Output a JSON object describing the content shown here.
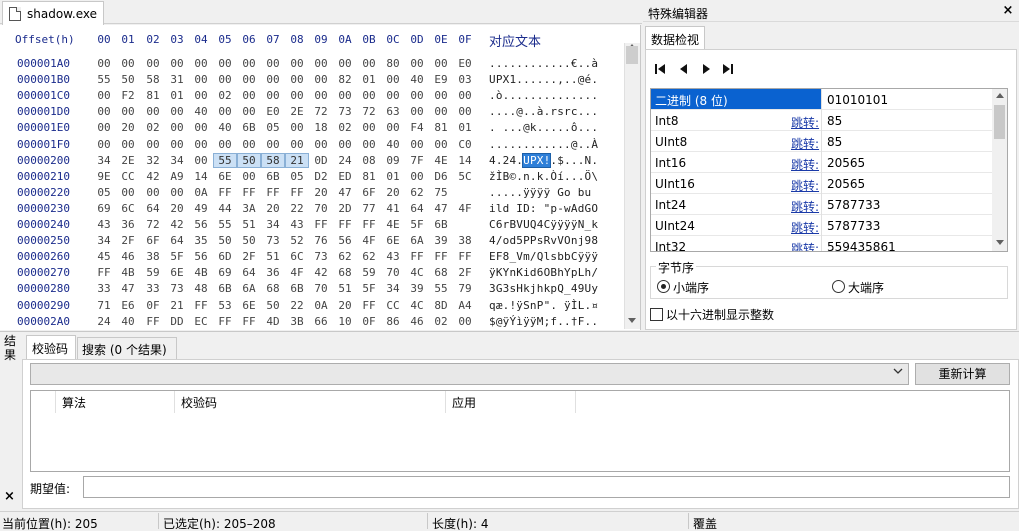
{
  "file_tab": {
    "label": "shadow.exe"
  },
  "hex": {
    "header_offset": "Offset(h)",
    "columns": [
      "00",
      "01",
      "02",
      "03",
      "04",
      "05",
      "06",
      "07",
      "08",
      "09",
      "0A",
      "0B",
      "0C",
      "0D",
      "0E",
      "0F"
    ],
    "header_text": "对应文本",
    "rows": [
      {
        "offset": "000001A0",
        "bytes": [
          "00",
          "00",
          "00",
          "00",
          "00",
          "00",
          "00",
          "00",
          "00",
          "00",
          "00",
          "00",
          "80",
          "00",
          "00",
          "E0"
        ],
        "text": "............€..à"
      },
      {
        "offset": "000001B0",
        "bytes": [
          "55",
          "50",
          "58",
          "31",
          "00",
          "00",
          "00",
          "00",
          "00",
          "00",
          "82",
          "01",
          "00",
          "40",
          "E9",
          "03"
        ],
        "text": "UPX1......‚..@é."
      },
      {
        "offset": "000001C0",
        "bytes": [
          "00",
          "F2",
          "81",
          "01",
          "00",
          "02",
          "00",
          "00",
          "00",
          "00",
          "00",
          "00",
          "00",
          "00",
          "00",
          "00"
        ],
        "text": ".ò.............."
      },
      {
        "offset": "000001D0",
        "bytes": [
          "00",
          "00",
          "00",
          "00",
          "40",
          "00",
          "00",
          "E0",
          "2E",
          "72",
          "73",
          "72",
          "63",
          "00",
          "00",
          "00"
        ],
        "text": "....@..à.rsrc..."
      },
      {
        "offset": "000001E0",
        "bytes": [
          "00",
          "20",
          "02",
          "00",
          "00",
          "40",
          "6B",
          "05",
          "00",
          "18",
          "02",
          "00",
          "00",
          "F4",
          "81",
          "01"
        ],
        "text": ". ...@k.....ô..."
      },
      {
        "offset": "000001F0",
        "bytes": [
          "00",
          "00",
          "00",
          "00",
          "00",
          "00",
          "00",
          "00",
          "00",
          "00",
          "00",
          "00",
          "40",
          "00",
          "00",
          "C0"
        ],
        "text": "............@..À"
      },
      {
        "offset": "00000200",
        "bytes": [
          "34",
          "2E",
          "32",
          "34",
          "00",
          "55",
          "50",
          "58",
          "21",
          "0D",
          "24",
          "08",
          "09",
          "7F",
          "4E",
          "14"
        ],
        "text_pre": "4.24.",
        "text_hl": "UPX!",
        "text_post": ".$...N."
      },
      {
        "offset": "00000210",
        "bytes": [
          "9E",
          "CC",
          "42",
          "A9",
          "14",
          "6E",
          "00",
          "6B",
          "05",
          "D2",
          "ED",
          "81",
          "01",
          "00",
          "D6",
          "5C"
        ],
        "text": "žÌB©.n.k.Òí...Ö\\"
      },
      {
        "offset": "00000220",
        "bytes": [
          "05",
          "00",
          "00",
          "00",
          "0A",
          "FF",
          "FF",
          "FF",
          "FF",
          "20",
          "47",
          "6F",
          "20",
          "62",
          "75"
        ],
        "text": ".....ÿÿÿÿ Go bu"
      },
      {
        "offset": "00000230",
        "bytes": [
          "69",
          "6C",
          "64",
          "20",
          "49",
          "44",
          "3A",
          "20",
          "22",
          "70",
          "2D",
          "77",
          "41",
          "64",
          "47",
          "4F"
        ],
        "text": "ild ID: \"p-wAdGO"
      },
      {
        "offset": "00000240",
        "bytes": [
          "43",
          "36",
          "72",
          "42",
          "56",
          "55",
          "51",
          "34",
          "43",
          "FF",
          "FF",
          "FF",
          "4E",
          "5F",
          "6B"
        ],
        "text": "C6rBVUQ4CÿÿÿÿN_k"
      },
      {
        "offset": "00000250",
        "bytes": [
          "34",
          "2F",
          "6F",
          "64",
          "35",
          "50",
          "50",
          "73",
          "52",
          "76",
          "56",
          "4F",
          "6E",
          "6A",
          "39",
          "38"
        ],
        "text": "4/od5PPsRvVOnj98"
      },
      {
        "offset": "00000260",
        "bytes": [
          "45",
          "46",
          "38",
          "5F",
          "56",
          "6D",
          "2F",
          "51",
          "6C",
          "73",
          "62",
          "62",
          "43",
          "FF",
          "FF",
          "FF"
        ],
        "text": "EF8_Vm/QlsbbCÿÿÿ"
      },
      {
        "offset": "00000270",
        "bytes": [
          "FF",
          "4B",
          "59",
          "6E",
          "4B",
          "69",
          "64",
          "36",
          "4F",
          "42",
          "68",
          "59",
          "70",
          "4C",
          "68",
          "2F"
        ],
        "text": "ÿKYnKid6OBhYpLh/"
      },
      {
        "offset": "00000280",
        "bytes": [
          "33",
          "47",
          "33",
          "73",
          "48",
          "6B",
          "6A",
          "68",
          "6B",
          "70",
          "51",
          "5F",
          "34",
          "39",
          "55",
          "79"
        ],
        "text": "3G3sHkjhkpQ_49Uy"
      },
      {
        "offset": "00000290",
        "bytes": [
          "71",
          "E6",
          "0F",
          "21",
          "FF",
          "53",
          "6E",
          "50",
          "22",
          "0A",
          "20",
          "FF",
          "CC",
          "4C",
          "8D",
          "A4"
        ],
        "text": "qæ.!ÿSnP\". ÿÌL.¤"
      },
      {
        "offset": "000002A0",
        "bytes": [
          "24",
          "40",
          "FF",
          "DD",
          "EC",
          "FF",
          "FF",
          "4D",
          "3B",
          "66",
          "10",
          "0F",
          "86",
          "46",
          "02",
          "00"
        ],
        "text": "$@ÿÝìÿÿM;f..†F.."
      }
    ]
  },
  "special_editor": {
    "title": "特殊编辑器",
    "close": "×",
    "tab": "数据检视",
    "jump_label": "跳转:",
    "rows": [
      {
        "name": "二进制 (8 位)",
        "value": "01010101",
        "jump": false
      },
      {
        "name": "Int8",
        "value": "85",
        "jump": true
      },
      {
        "name": "UInt8",
        "value": "85",
        "jump": true
      },
      {
        "name": "Int16",
        "value": "20565",
        "jump": true
      },
      {
        "name": "UInt16",
        "value": "20565",
        "jump": true
      },
      {
        "name": "Int24",
        "value": "5787733",
        "jump": true
      },
      {
        "name": "UInt24",
        "value": "5787733",
        "jump": true
      },
      {
        "name": "Int32",
        "value": "559435861",
        "jump": true
      }
    ],
    "byte_order_label": "字节序",
    "little_endian": "小端序",
    "big_endian": "大端序",
    "hex_display": "以十六进制显示整数"
  },
  "results": {
    "side_label": "结果",
    "close": "×",
    "tab_checksum": "校验码",
    "tab_search": "搜索 (0 个结果)",
    "recalc": "重新计算",
    "col_algo": "算法",
    "col_checksum": "校验码",
    "col_apply": "应用",
    "expected_label": "期望值:"
  },
  "status": {
    "position": "当前位置(h): 205",
    "selected": "已选定(h): 205–208",
    "length": "长度(h): 4",
    "mode": "覆盖"
  }
}
